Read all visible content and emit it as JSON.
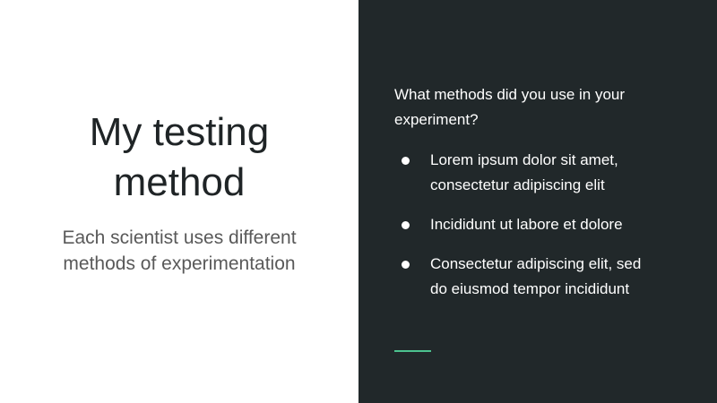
{
  "slide": {
    "title_line1": "My testing",
    "title_line2": "method",
    "subtitle_line1": "Each scientist uses different",
    "subtitle_line2": "methods of experimentation",
    "question_line1": "What methods did you use in your",
    "question_line2": "experiment?",
    "bullets": [
      {
        "line1": "Lorem ipsum dolor sit amet,",
        "line2": "consectetur adipiscing elit"
      },
      {
        "line1": "Incididunt ut labore et dolore",
        "line2": ""
      },
      {
        "line1": "Consectetur adipiscing elit, sed",
        "line2": "do eiusmod tempor incididunt"
      }
    ]
  },
  "colors": {
    "dark_panel": "#21282a",
    "accent": "#4cc38f",
    "title_text": "#1f2426",
    "subtitle_text": "#595959"
  }
}
